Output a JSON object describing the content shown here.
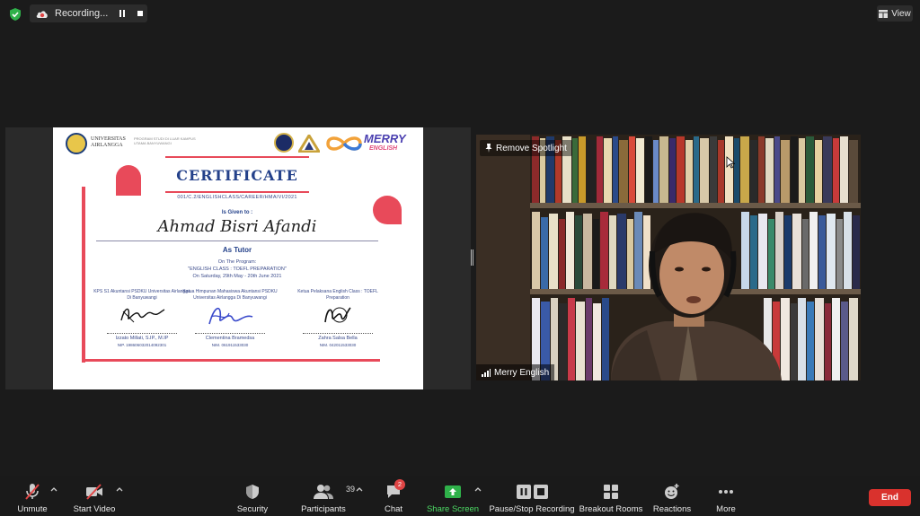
{
  "top": {
    "recording_label": "Recording...",
    "view_label": "View"
  },
  "certificate": {
    "university": "UNIVERSITAS AIRLANGGA",
    "university_sub": "PROGRAM STUDI DI LUAR KAMPUS UTAMA BANYUWANGI",
    "brand_merry": "MERRY",
    "brand_english": "ENGLISH",
    "title": "CERTIFICATE",
    "number": "001/C.2/ENGLISHCLASS/CAREER/HMA/VI/2021",
    "given_to": "Is Given to :",
    "recipient": "Ahmad Bisri Afandi",
    "role": "As Tutor",
    "program_line1": "On The Program:",
    "program_line2": "\"ENGLISH CLASS : TOEFL PREPARATION\"",
    "program_line3": "On Saturday, 29th May - 20th June 2021",
    "signatories": [
      {
        "role_lines": "KPS S1 Akuntansi PSDKU Universitas Airlangga Di Banyuwangi",
        "name": "Izzato Millati, S.IP., M.IP",
        "nip": "NIP. 198606032014092301"
      },
      {
        "role_lines": "Ketua Himpunan Mahasiswa Akuntansi PSDKU Universitas Airlangga Di Banyuwangi",
        "name": "Clementina Bramedsa",
        "nip": "NIM. 061911533030"
      },
      {
        "role_lines": "Ketua Pelaksana English Class : TOEFL Preparation",
        "name": "Zahra Salsa Bella",
        "nip": "NIM. 042011533030"
      }
    ]
  },
  "video": {
    "pin_label": "Remove Spotlight",
    "participant_name": "Merry English"
  },
  "toolbar": {
    "unmute": "Unmute",
    "start_video": "Start Video",
    "security": "Security",
    "participants": "Participants",
    "participants_count": "39",
    "chat": "Chat",
    "chat_badge": "2",
    "share_screen": "Share Screen",
    "pause_stop": "Pause/Stop Recording",
    "breakout": "Breakout Rooms",
    "reactions": "Reactions",
    "more": "More",
    "end": "End"
  },
  "colors": {
    "share_green": "#4cd964",
    "end_red": "#d9322d",
    "cert_accent": "#e84a5a",
    "cert_blue": "#24418a"
  }
}
